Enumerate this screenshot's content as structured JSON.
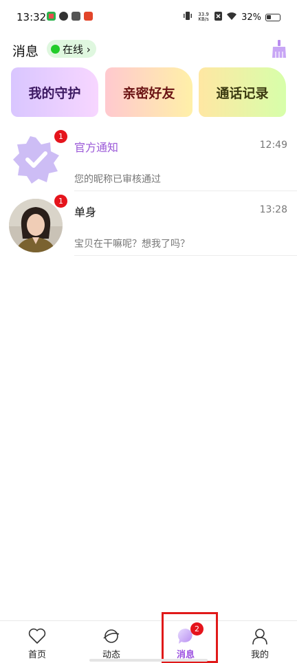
{
  "status_bar": {
    "time": "13:32",
    "net_speed_value": "33.9",
    "net_speed_unit": "KB/s",
    "battery": "32%"
  },
  "header": {
    "title": "消息",
    "online_label": "在线 ›"
  },
  "cards": [
    {
      "label": "我的守护"
    },
    {
      "label": "亲密好友"
    },
    {
      "label": "通话记录"
    }
  ],
  "messages": [
    {
      "name": "官方通知",
      "time": "12:49",
      "preview": "您的昵称已审核通过",
      "badge": "1",
      "name_color": "#9b59d8"
    },
    {
      "name": "单身",
      "time": "13:28",
      "preview": "宝贝在干嘛呢？想我了吗？",
      "badge": "1",
      "name_color": "#111111"
    }
  ],
  "bottom_nav": {
    "items": [
      {
        "label": "首页",
        "icon": "heart-icon"
      },
      {
        "label": "动态",
        "icon": "planet-icon"
      },
      {
        "label": "消息",
        "icon": "chat-bubble-icon",
        "badge": "2",
        "active": true
      },
      {
        "label": "我的",
        "icon": "user-icon"
      }
    ]
  },
  "colors": {
    "accent": "#9b4fe0",
    "badge": "#e5141c",
    "online": "#22cc2a"
  }
}
